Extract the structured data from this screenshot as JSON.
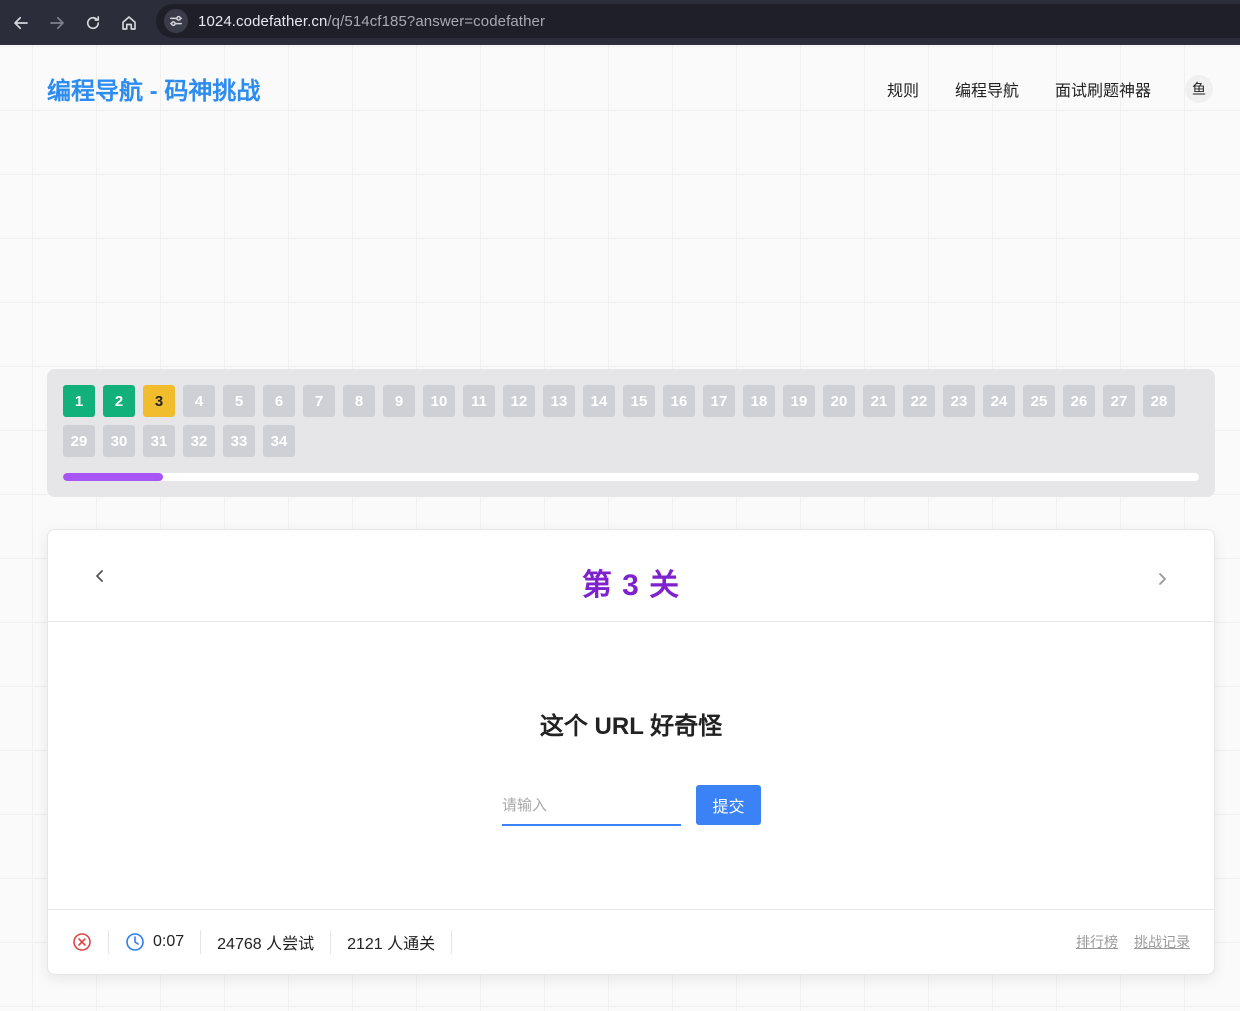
{
  "browser": {
    "url_host": "1024.codefather.cn",
    "url_path": "/q/514cf185?answer=codefather"
  },
  "header": {
    "title": "编程导航 - 码神挑战",
    "nav": [
      "规则",
      "编程导航",
      "面试刷题神器"
    ],
    "avatar_text": "鱼"
  },
  "levels": {
    "items": [
      "1",
      "2",
      "3",
      "4",
      "5",
      "6",
      "7",
      "8",
      "9",
      "10",
      "11",
      "12",
      "13",
      "14",
      "15",
      "16",
      "17",
      "18",
      "19",
      "20",
      "21",
      "22",
      "23",
      "24",
      "25",
      "26",
      "27",
      "28",
      "29",
      "30",
      "31",
      "32",
      "33",
      "34"
    ],
    "passed": [
      "1",
      "2"
    ],
    "current": "3",
    "progress": 0.088
  },
  "challenge": {
    "level_title": "第 3 关",
    "question": "这个 URL 好奇怪",
    "input_placeholder": "请输入",
    "input_value": "",
    "submit_label": "提交"
  },
  "footer": {
    "timer": "0:07",
    "attempts": "24768 人尝试",
    "passed": "2121 人通关",
    "leaderboard_label": "排行榜",
    "records_label": "挑战记录"
  },
  "colors": {
    "brand": "#2d8cf0",
    "level_title": "#7e22ce",
    "passed_level": "#12b07a",
    "current_level": "#f2bd2d",
    "progress": "#a855f7",
    "primary_button": "#3b82f6"
  }
}
